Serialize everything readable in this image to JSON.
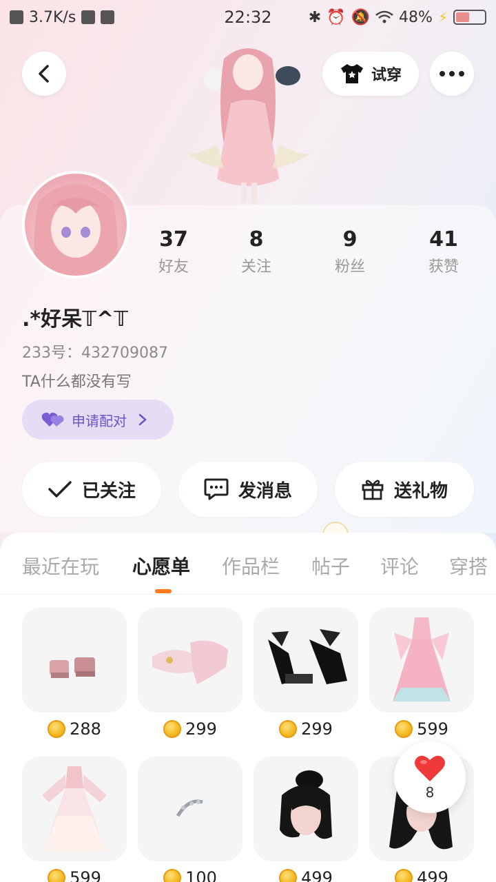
{
  "status_bar": {
    "network_speed": "3.7K/s",
    "time": "22:32",
    "battery": "48%",
    "battery_level": 0.48
  },
  "header": {
    "try_on_label": "试穿"
  },
  "profile": {
    "stats": [
      {
        "num": "37",
        "label": "好友"
      },
      {
        "num": "8",
        "label": "关注"
      },
      {
        "num": "9",
        "label": "粉丝"
      },
      {
        "num": "41",
        "label": "获赞"
      }
    ],
    "nickname": ".*好呆𝕋^𝕋",
    "uid": "233号：432709087",
    "bio": "TA什么都没有写",
    "match_label": "申请配对"
  },
  "actions": {
    "followed": "已关注",
    "message": "发消息",
    "gift": "送礼物"
  },
  "tabs": [
    "最近在玩",
    "心愿单",
    "作品栏",
    "帖子",
    "评论",
    "穿搭"
  ],
  "active_tab": "心愿单",
  "wishlist": [
    {
      "item": "pink platform shoes",
      "price": "288"
    },
    {
      "item": "pink glass heels",
      "price": "299"
    },
    {
      "item": "black bow platform shoes",
      "price": "299"
    },
    {
      "item": "pink hanfu dress",
      "price": "599"
    },
    {
      "item": "pink white gown",
      "price": "599"
    },
    {
      "item": "silver hair clip",
      "price": "100"
    },
    {
      "item": "black bun hairstyle",
      "price": "499"
    },
    {
      "item": "black long hairstyle",
      "price": "499"
    }
  ],
  "favorite": {
    "count": "8"
  },
  "colors": {
    "accent_orange": "#ff7a1a",
    "match_purple": "#6a55c6",
    "heart_red": "#f03a3a"
  }
}
